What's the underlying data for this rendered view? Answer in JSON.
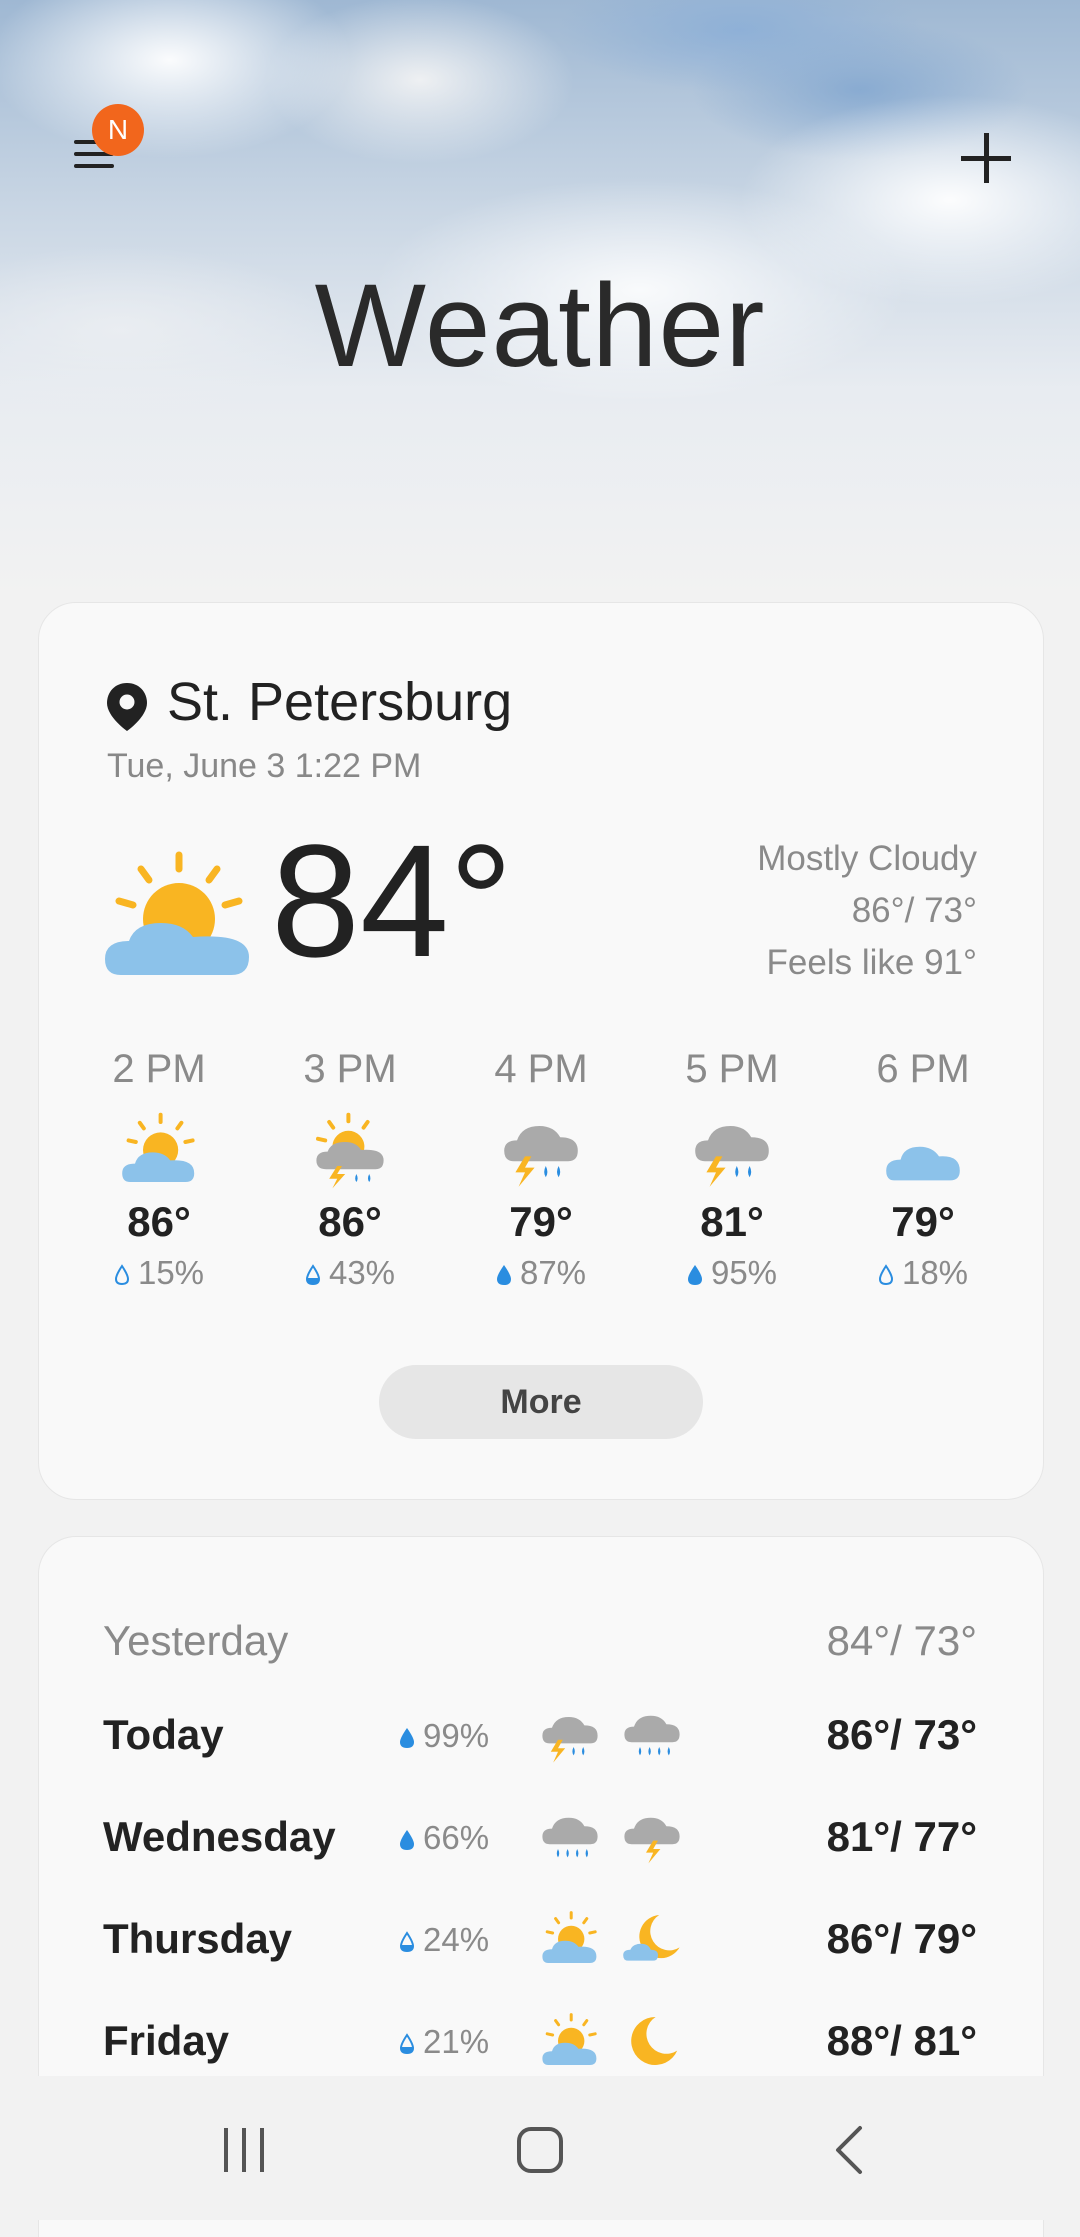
{
  "header": {
    "title": "Weather",
    "notification_badge": "N",
    "menu_icon": "hamburger-menu-icon",
    "add_icon": "plus-icon"
  },
  "current": {
    "location": "St. Petersburg",
    "datetime": "Tue, June 3 1:22 PM",
    "temperature": "84°",
    "condition": "Mostly Cloudy",
    "hi_lo": "86°/ 73°",
    "feels_like": "Feels like 91°",
    "icon": "partly-cloudy-icon"
  },
  "hourly": [
    {
      "time": "2 PM",
      "icon": "partly-cloudy-icon",
      "temp": "86°",
      "precip": "15%"
    },
    {
      "time": "3 PM",
      "icon": "partly-cloudy-thunderstorm-icon",
      "temp": "86°",
      "precip": "43%"
    },
    {
      "time": "4 PM",
      "icon": "thunderstorm-icon",
      "temp": "79°",
      "precip": "87%"
    },
    {
      "time": "5 PM",
      "icon": "thunderstorm-icon",
      "temp": "81°",
      "precip": "95%"
    },
    {
      "time": "6 PM",
      "icon": "cloud-icon",
      "temp": "79°",
      "precip": "18%"
    }
  ],
  "more_label": "More",
  "daily": {
    "yesterday": {
      "label": "Yesterday",
      "hi_lo": "84°/ 73°"
    },
    "days": [
      {
        "day": "Today",
        "precip": "99%",
        "day_icon": "thunderstorm-icon",
        "night_icon": "rain-icon",
        "hi_lo": "86°/ 73°"
      },
      {
        "day": "Wednesday",
        "precip": "66%",
        "day_icon": "rain-icon",
        "night_icon": "thunder-cloud-icon",
        "hi_lo": "81°/ 77°"
      },
      {
        "day": "Thursday",
        "precip": "24%",
        "day_icon": "partly-cloudy-icon",
        "night_icon": "partly-cloudy-night-icon",
        "hi_lo": "86°/ 79°"
      },
      {
        "day": "Friday",
        "precip": "21%",
        "day_icon": "partly-cloudy-icon",
        "night_icon": "moon-icon",
        "hi_lo": "88°/ 81°"
      }
    ]
  },
  "colors": {
    "sun": "#f9b522",
    "cloud": "#8cc2ea",
    "storm_cloud": "#aaaaaa",
    "rain": "#2a8de0",
    "badge": "#f2661c"
  },
  "nav": {
    "recents_icon": "recent-apps-icon",
    "home_icon": "home-icon",
    "back_icon": "back-icon"
  }
}
